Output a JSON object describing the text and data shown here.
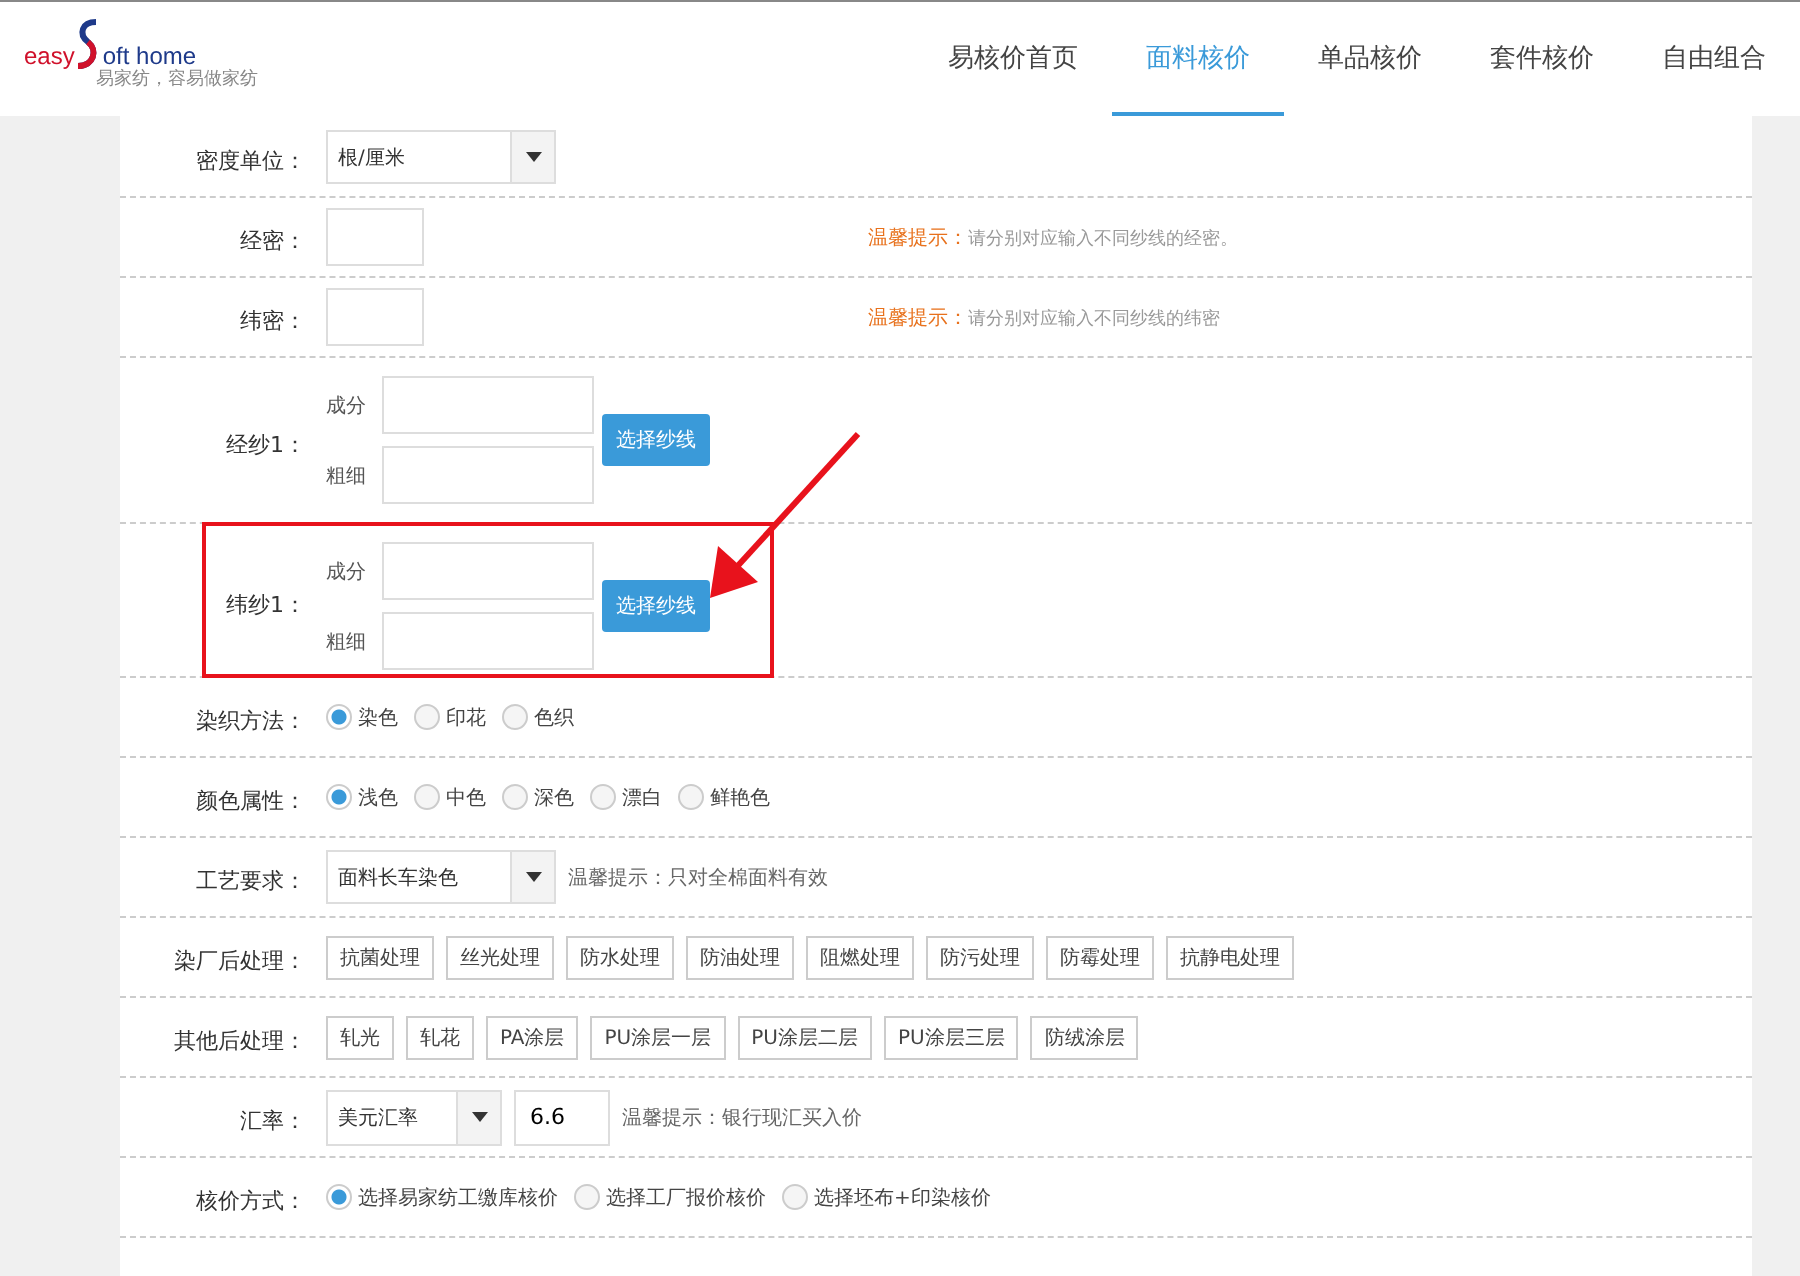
{
  "header": {
    "logo": {
      "word_left": "easy",
      "word_right": "oft home",
      "tagline": "易家纺，容易做家纺"
    },
    "nav": [
      {
        "label": "易核价首页",
        "selected": false
      },
      {
        "label": "面料核价",
        "selected": true
      },
      {
        "label": "单品核价",
        "selected": false
      },
      {
        "label": "套件核价",
        "selected": false
      },
      {
        "label": "自由组合",
        "selected": false
      }
    ]
  },
  "form": [
    {
      "kind": "select",
      "label": "密度单位：",
      "value": "根/厘米"
    },
    {
      "kind": "input_hint",
      "label": "经密：",
      "hint_label": "温馨提示：",
      "hint_text": "请分别对应输入不同纱线的经密。"
    },
    {
      "kind": "input_hint",
      "label": "纬密：",
      "hint_label": "温馨提示：",
      "hint_text": "请分别对应输入不同纱线的纬密"
    },
    {
      "kind": "yarn",
      "label": "经纱1：",
      "field_1": "成分",
      "field_2": "粗细",
      "button": "选择纱线",
      "highlighted": false
    },
    {
      "kind": "yarn",
      "label": "纬纱1：",
      "field_1": "成分",
      "field_2": "粗细",
      "button": "选择纱线",
      "highlighted": true
    },
    {
      "kind": "radio",
      "label": "染织方法：",
      "options": [
        {
          "label": "染色",
          "selected": true
        },
        {
          "label": "印花",
          "selected": false
        },
        {
          "label": "色织",
          "selected": false
        }
      ]
    },
    {
      "kind": "radio",
      "label": "颜色属性：",
      "options": [
        {
          "label": "浅色",
          "selected": true
        },
        {
          "label": "中色",
          "selected": false
        },
        {
          "label": "深色",
          "selected": false
        },
        {
          "label": "漂白",
          "selected": false
        },
        {
          "label": "鲜艳色",
          "selected": false
        }
      ]
    },
    {
      "kind": "select_hint",
      "label": "工艺要求：",
      "value": "面料长车染色",
      "hint": "温馨提示：只对全棉面料有效"
    },
    {
      "kind": "tags",
      "label": "染厂后处理：",
      "tags": [
        "抗菌处理",
        "丝光处理",
        "防水处理",
        "防油处理",
        "阻燃处理",
        "防污处理",
        "防霉处理",
        "抗静电处理"
      ]
    },
    {
      "kind": "tags",
      "label": "其他后处理：",
      "tags": [
        "轧光",
        "轧花",
        "PA涂层",
        "PU涂层一层",
        "PU涂层二层",
        "PU涂层三层",
        "防绒涂层"
      ]
    },
    {
      "kind": "rate",
      "label": "汇率：",
      "value": "美元汇率",
      "rate": "6.6",
      "hint": "温馨提示：银行现汇买入价"
    },
    {
      "kind": "radio",
      "label": "核价方式：",
      "options": [
        {
          "label": "选择易家纺工缴库核价",
          "selected": true
        },
        {
          "label": "选择工厂报价核价",
          "selected": false
        },
        {
          "label": "选择坯布+印染核价",
          "selected": false
        }
      ]
    }
  ]
}
